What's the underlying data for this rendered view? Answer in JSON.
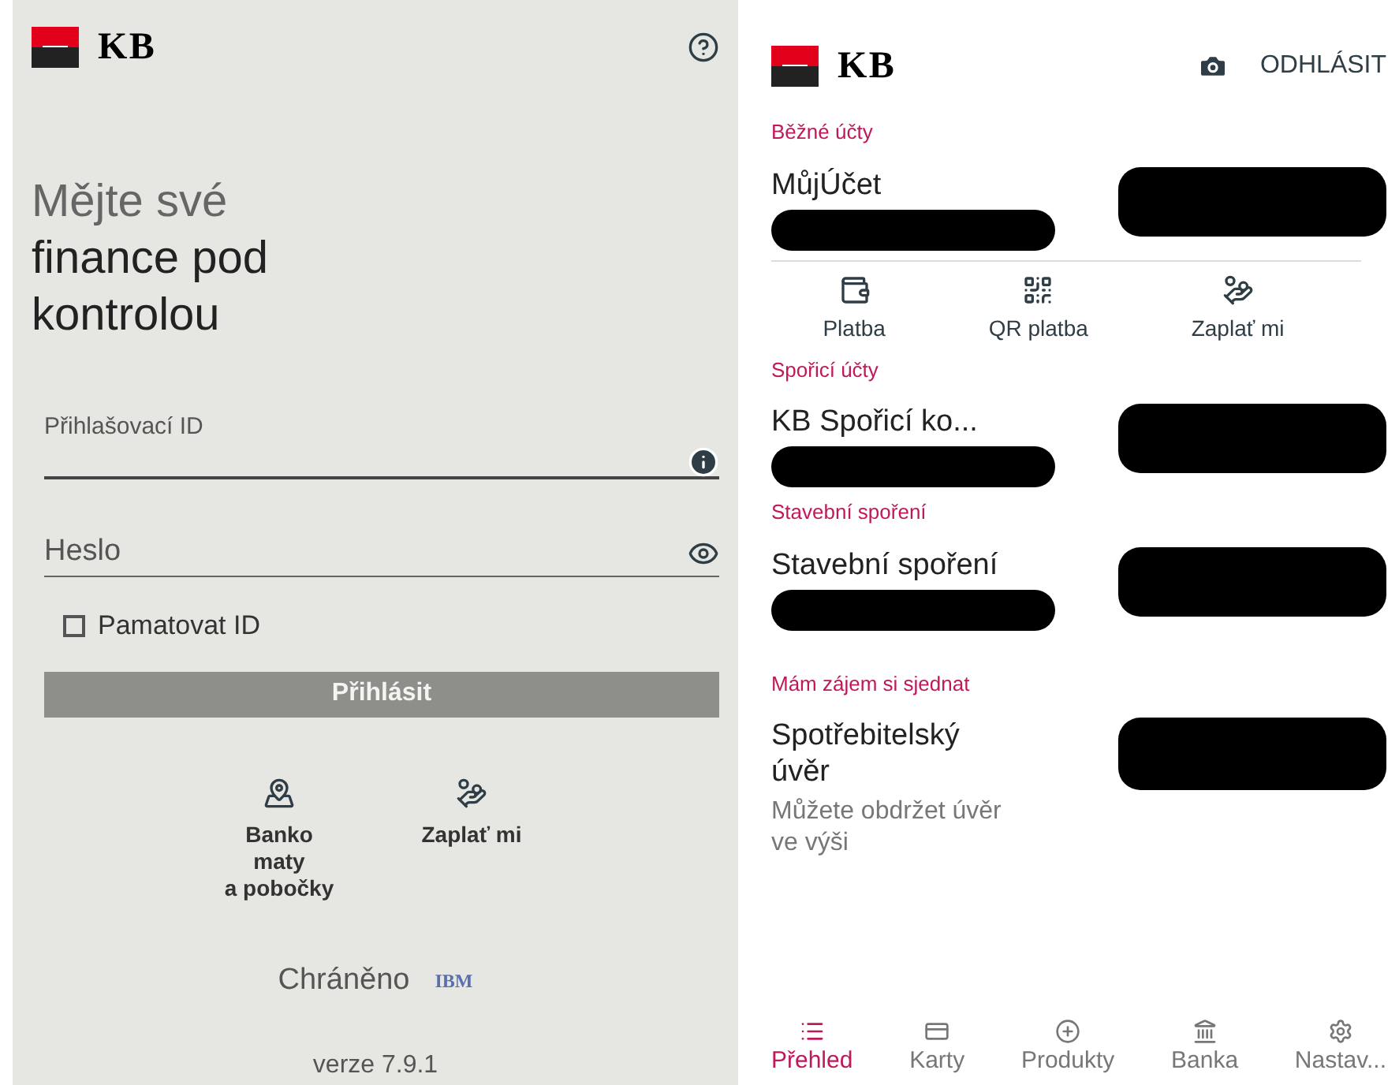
{
  "login_screen": {
    "logo": "KB",
    "headline": [
      {
        "text": "Mějte své",
        "muted": true
      },
      {
        "text": "finance pod",
        "muted": false
      },
      {
        "text": "kontrolou",
        "muted": false
      }
    ],
    "login_id": {
      "label": "Přihlašovací ID"
    },
    "password": {
      "placeholder": "Heslo"
    },
    "remember_id": {
      "label": "Pamatovat ID",
      "checked": false
    },
    "login_button": {
      "label": "Přihlásit",
      "disabled": true
    },
    "shortcuts": [
      {
        "kind": "map",
        "label": "Banko\nmaty\na pobočky"
      },
      {
        "kind": "pay",
        "label": "Zaplať mi"
      }
    ],
    "protected": "Chráněno",
    "protected_by": "IBM",
    "version": "verze 7.9.1"
  },
  "overview_screen": {
    "logo": "KB",
    "logout": "ODHLÁSIT",
    "sections": [
      {
        "title": "Běžné účty",
        "items": [
          {
            "kind": "account",
            "name": "MůjÚčet",
            "actions": [
              {
                "kind": "wallet",
                "label": "Platba"
              },
              {
                "kind": "qr",
                "label": "QR platba"
              },
              {
                "kind": "pay",
                "label": "Zaplať mi"
              }
            ]
          }
        ]
      },
      {
        "title": "Spořicí účty",
        "items": [
          {
            "kind": "account",
            "name": "KB Spořicí ko..."
          }
        ]
      },
      {
        "title": "Stavební spoření",
        "items": [
          {
            "kind": "account",
            "name": "Stavební spoření"
          }
        ]
      },
      {
        "title": "Mám zájem si sjednat",
        "items": [
          {
            "kind": "offer",
            "name": "Spotřebitelský\núvěr",
            "note": "Můžete obdržet úvěr\nve výši"
          }
        ]
      }
    ],
    "nav": [
      {
        "kind": "list",
        "label": "Přehled",
        "selected": true
      },
      {
        "kind": "card",
        "label": "Karty",
        "selected": false
      },
      {
        "kind": "plus",
        "label": "Produkty",
        "selected": false
      },
      {
        "kind": "bank",
        "label": "Banka",
        "selected": false
      },
      {
        "kind": "gear",
        "label": "Nastav...",
        "selected": false
      }
    ]
  }
}
